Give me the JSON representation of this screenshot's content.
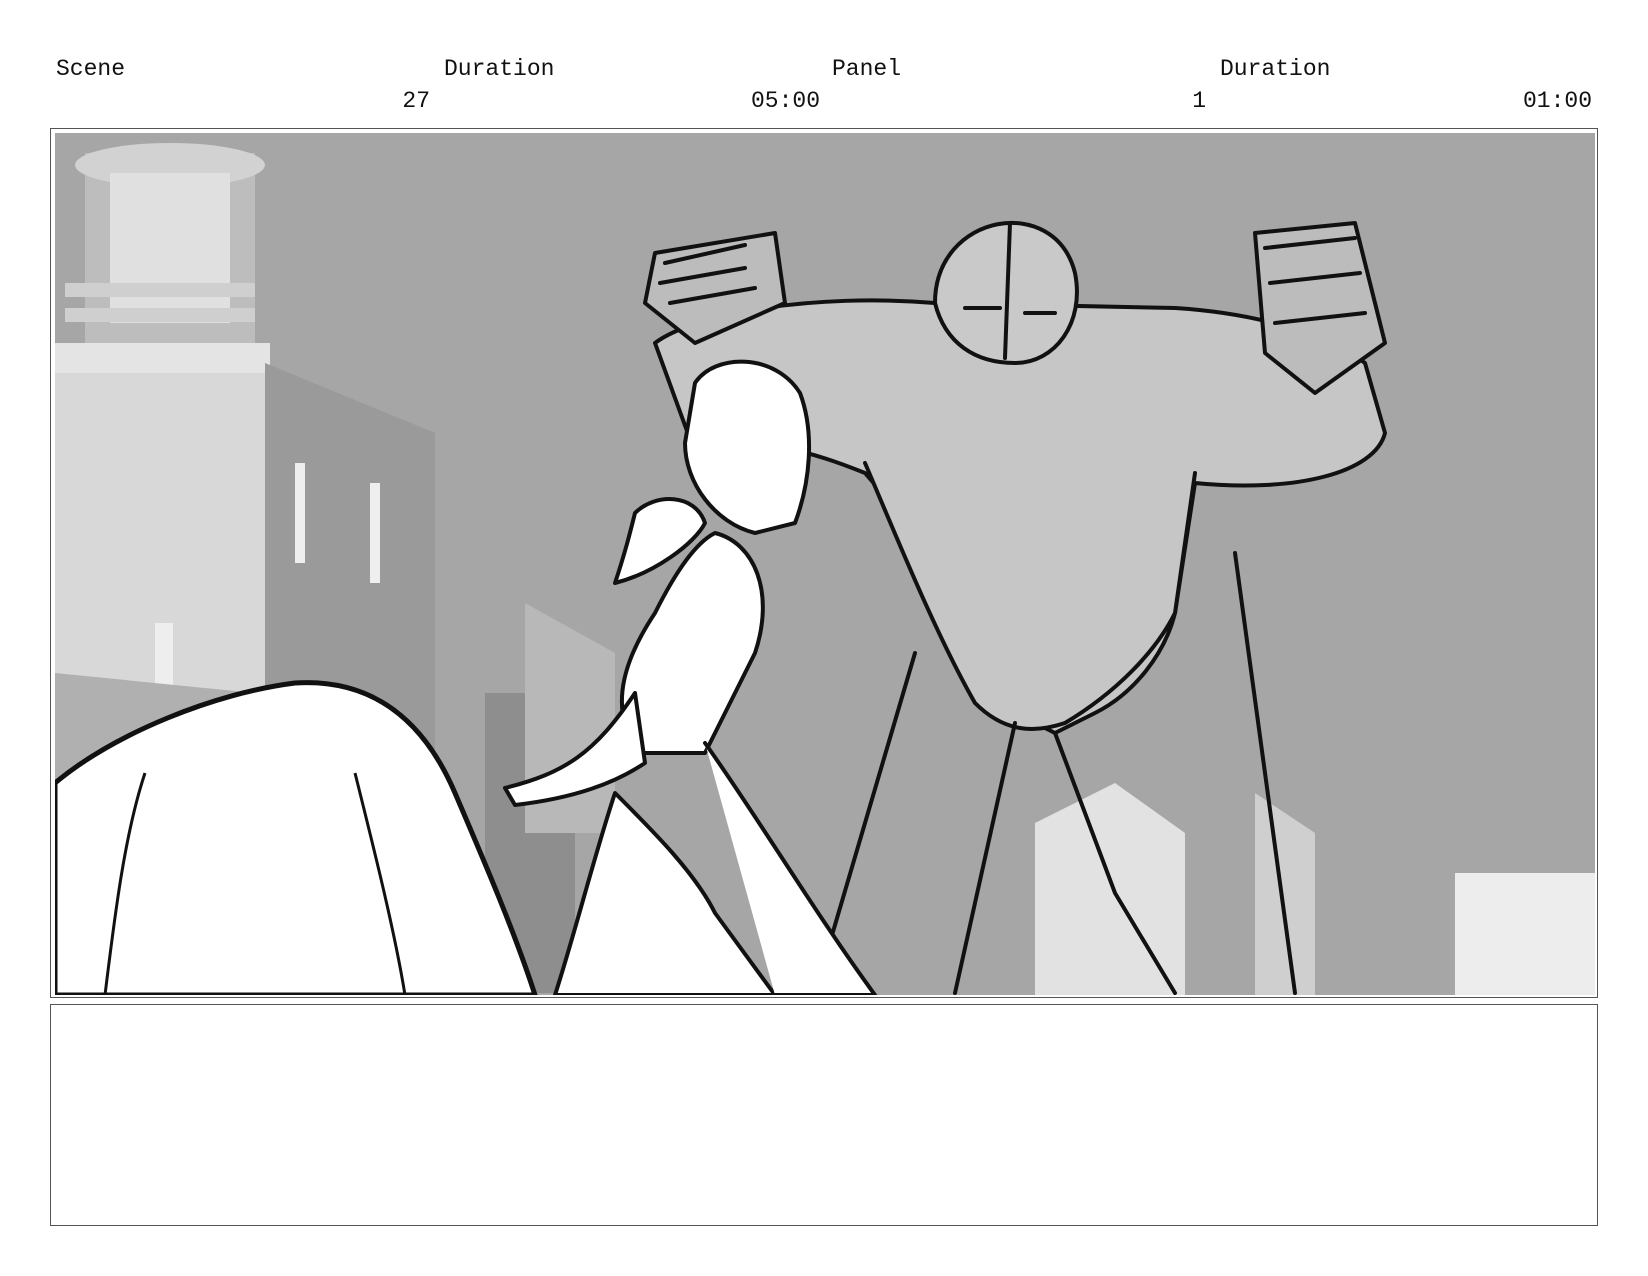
{
  "header": {
    "scene_label": "Scene",
    "scene_value": "27",
    "scene_duration_label": "Duration",
    "scene_duration_value": "05:00",
    "panel_label": "Panel",
    "panel_value": "1",
    "panel_duration_label": "Duration",
    "panel_duration_value": "01:00"
  },
  "panel": {
    "background_color": "#a6a6a6",
    "line_color": "#111111"
  },
  "notes": {
    "text": ""
  }
}
